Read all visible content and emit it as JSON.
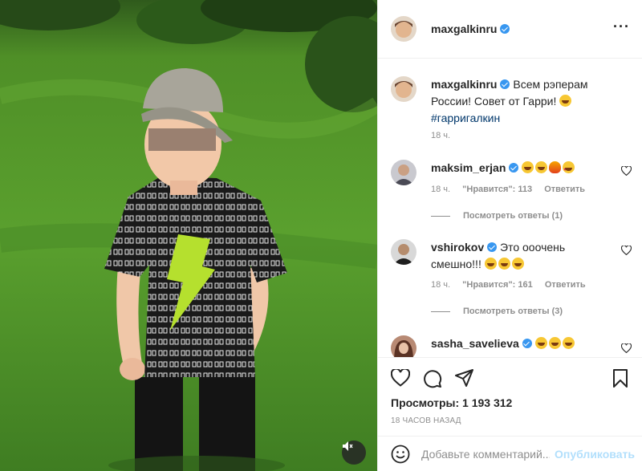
{
  "post": {
    "author": "maxgalkinru",
    "caption": "Всем рэперам России! Совет от Гарри!",
    "hashtag": "#гарригалкин",
    "caption_time": "18 ч."
  },
  "comments": [
    {
      "username": "maksim_erjan",
      "text": "",
      "time": "18 ч.",
      "likes": "\"Нравится\": 113",
      "reply_label": "Ответить",
      "view_replies": "Посмотреть ответы (1)"
    },
    {
      "username": "vshirokov",
      "text": "Это ооочень смешно!!!",
      "time": "18 ч.",
      "likes": "\"Нравится\": 161",
      "reply_label": "Ответить",
      "view_replies": "Посмотреть ответы (3)"
    },
    {
      "username": "sasha_savelieva",
      "text": ""
    }
  ],
  "stats": {
    "views": "Просмотры: 1 193 312",
    "timestamp": "18 ЧАСОВ НАЗАД"
  },
  "comment_box": {
    "placeholder": "Добавьте комментарий...",
    "publish_label": "Опубликовать"
  },
  "icons": {
    "mute": "speaker-muted-icon",
    "like": "heart-icon",
    "comment": "comment-icon",
    "share": "paper-plane-icon",
    "save": "bookmark-icon",
    "more": "more-options-icon",
    "emoji": "smiley-icon"
  },
  "colors": {
    "verified": "#3897f0",
    "hashtag": "#00376b",
    "publish_disabled": "#b2dffc",
    "muted_text": "#8e8e8e"
  }
}
